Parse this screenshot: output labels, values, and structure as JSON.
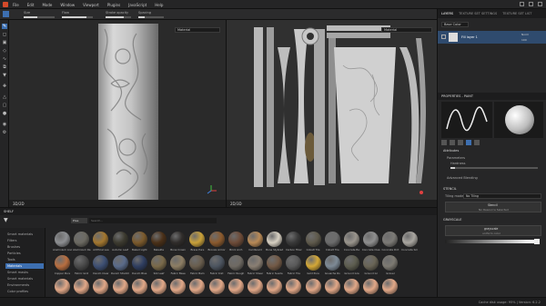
{
  "menubar": {
    "items": [
      "File",
      "Edit",
      "Mode",
      "Window",
      "Viewport",
      "Plugins",
      "JavaScript",
      "Help"
    ]
  },
  "toolbar": {
    "size_label": "Size",
    "flow_label": "Flow",
    "stroke_opacity_label": "Stroke opacity",
    "spacing_label": "Spacing",
    "size_fill": 0.45,
    "flow_fill": 0.8,
    "opacity_fill": 0.7,
    "spacing_fill": 0.25
  },
  "viewport3d": {
    "title": "3D/2D",
    "material_dropdown": "Material"
  },
  "viewport2d": {
    "title": "2D/3D",
    "material_dropdown": "Material"
  },
  "layers_panel": {
    "tabs": [
      "LAYERS",
      "TEXTURE SET SETTINGS",
      "TEXTURE SET LIST"
    ],
    "blend_dropdown": "Base Color",
    "layer_name": "Fill layer 1",
    "blend_mode": "Norm",
    "opacity": "100"
  },
  "properties_panel": {
    "header": "PROPERTIES - PAINT",
    "attributes": "Attributes",
    "parameters": "Parameters",
    "hardness_label": "Hardness",
    "advanced_label": "Advanced Blending",
    "stencil": "STENCIL",
    "tiling_label": "Tiling mode",
    "tiling_value": "No Tiling",
    "stencil_button": "Stencil",
    "stencil_value": "No Resource Selected",
    "grayscale": "GRAYSCALE",
    "grayscale_button": "grayscale",
    "grayscale_value": "uniform color",
    "hardness_fill": 0.05
  },
  "shelf": {
    "title": "SHELF",
    "search_placeholder": "Search...",
    "filter_chip": "Pres",
    "categories": [
      "Smart materials",
      "Filters",
      "Brushes",
      "Particles",
      "Tools",
      "Materials",
      "Smart masks",
      "Smart materials",
      "Environments",
      "Color profiles"
    ],
    "active_category": 5,
    "materials_row1": [
      "Aluminium Ano",
      "Aluminium Ra",
      "Artificial Lea",
      "Autumn Leaf",
      "Baked Light",
      "Bakelite",
      "Bone Crown",
      "Brass Pure",
      "Bronze Armor",
      "Brick Arch",
      "Cardboard",
      "Bone Stylized",
      "Carbon Fiber",
      "Cobalt Tile",
      "Cobalt Tile",
      "Concrete Be",
      "Concrete Clea",
      "Concrete Dirt",
      "Concrete Sm"
    ],
    "materials_row2": [
      "Copper Pure",
      "Fabric Grid",
      "Denim Clear",
      "Denim Stretch",
      "Denim Blue",
      "Silk Leaf",
      "Fabric Base",
      "Fabric Bam",
      "Fabric Knit",
      "Fabric Rough",
      "Fabric Sheer",
      "Fabric Suede",
      "Fabric Tile",
      "Gold Pure",
      "Gouache Ro",
      "Ground Gra",
      "Ground Gr",
      "Gravel"
    ],
    "materials_row3": [
      "",
      "",
      "",
      "",
      "",
      "",
      "",
      "",
      "",
      "",
      "",
      "",
      "",
      "",
      "",
      "",
      "",
      ""
    ]
  },
  "status": {
    "text": "Cache disk usage: 95% | Version: 6.2.2"
  },
  "colors": {
    "accent": "#3d6fb0",
    "panel": "#262627",
    "viewport": "#2a2a2a"
  }
}
